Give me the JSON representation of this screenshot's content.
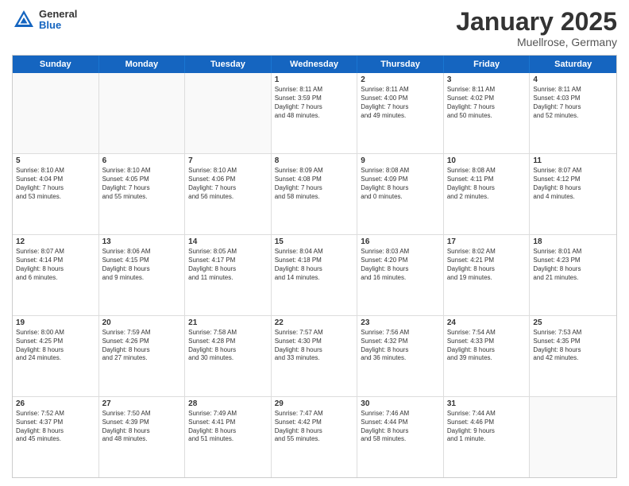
{
  "logo": {
    "general": "General",
    "blue": "Blue"
  },
  "header": {
    "title": "January 2025",
    "subtitle": "Muellrose, Germany"
  },
  "weekdays": [
    "Sunday",
    "Monday",
    "Tuesday",
    "Wednesday",
    "Thursday",
    "Friday",
    "Saturday"
  ],
  "weeks": [
    [
      {
        "day": "",
        "text": ""
      },
      {
        "day": "",
        "text": ""
      },
      {
        "day": "",
        "text": ""
      },
      {
        "day": "1",
        "text": "Sunrise: 8:11 AM\nSunset: 3:59 PM\nDaylight: 7 hours\nand 48 minutes."
      },
      {
        "day": "2",
        "text": "Sunrise: 8:11 AM\nSunset: 4:00 PM\nDaylight: 7 hours\nand 49 minutes."
      },
      {
        "day": "3",
        "text": "Sunrise: 8:11 AM\nSunset: 4:02 PM\nDaylight: 7 hours\nand 50 minutes."
      },
      {
        "day": "4",
        "text": "Sunrise: 8:11 AM\nSunset: 4:03 PM\nDaylight: 7 hours\nand 52 minutes."
      }
    ],
    [
      {
        "day": "5",
        "text": "Sunrise: 8:10 AM\nSunset: 4:04 PM\nDaylight: 7 hours\nand 53 minutes."
      },
      {
        "day": "6",
        "text": "Sunrise: 8:10 AM\nSunset: 4:05 PM\nDaylight: 7 hours\nand 55 minutes."
      },
      {
        "day": "7",
        "text": "Sunrise: 8:10 AM\nSunset: 4:06 PM\nDaylight: 7 hours\nand 56 minutes."
      },
      {
        "day": "8",
        "text": "Sunrise: 8:09 AM\nSunset: 4:08 PM\nDaylight: 7 hours\nand 58 minutes."
      },
      {
        "day": "9",
        "text": "Sunrise: 8:08 AM\nSunset: 4:09 PM\nDaylight: 8 hours\nand 0 minutes."
      },
      {
        "day": "10",
        "text": "Sunrise: 8:08 AM\nSunset: 4:11 PM\nDaylight: 8 hours\nand 2 minutes."
      },
      {
        "day": "11",
        "text": "Sunrise: 8:07 AM\nSunset: 4:12 PM\nDaylight: 8 hours\nand 4 minutes."
      }
    ],
    [
      {
        "day": "12",
        "text": "Sunrise: 8:07 AM\nSunset: 4:14 PM\nDaylight: 8 hours\nand 6 minutes."
      },
      {
        "day": "13",
        "text": "Sunrise: 8:06 AM\nSunset: 4:15 PM\nDaylight: 8 hours\nand 9 minutes."
      },
      {
        "day": "14",
        "text": "Sunrise: 8:05 AM\nSunset: 4:17 PM\nDaylight: 8 hours\nand 11 minutes."
      },
      {
        "day": "15",
        "text": "Sunrise: 8:04 AM\nSunset: 4:18 PM\nDaylight: 8 hours\nand 14 minutes."
      },
      {
        "day": "16",
        "text": "Sunrise: 8:03 AM\nSunset: 4:20 PM\nDaylight: 8 hours\nand 16 minutes."
      },
      {
        "day": "17",
        "text": "Sunrise: 8:02 AM\nSunset: 4:21 PM\nDaylight: 8 hours\nand 19 minutes."
      },
      {
        "day": "18",
        "text": "Sunrise: 8:01 AM\nSunset: 4:23 PM\nDaylight: 8 hours\nand 21 minutes."
      }
    ],
    [
      {
        "day": "19",
        "text": "Sunrise: 8:00 AM\nSunset: 4:25 PM\nDaylight: 8 hours\nand 24 minutes."
      },
      {
        "day": "20",
        "text": "Sunrise: 7:59 AM\nSunset: 4:26 PM\nDaylight: 8 hours\nand 27 minutes."
      },
      {
        "day": "21",
        "text": "Sunrise: 7:58 AM\nSunset: 4:28 PM\nDaylight: 8 hours\nand 30 minutes."
      },
      {
        "day": "22",
        "text": "Sunrise: 7:57 AM\nSunset: 4:30 PM\nDaylight: 8 hours\nand 33 minutes."
      },
      {
        "day": "23",
        "text": "Sunrise: 7:56 AM\nSunset: 4:32 PM\nDaylight: 8 hours\nand 36 minutes."
      },
      {
        "day": "24",
        "text": "Sunrise: 7:54 AM\nSunset: 4:33 PM\nDaylight: 8 hours\nand 39 minutes."
      },
      {
        "day": "25",
        "text": "Sunrise: 7:53 AM\nSunset: 4:35 PM\nDaylight: 8 hours\nand 42 minutes."
      }
    ],
    [
      {
        "day": "26",
        "text": "Sunrise: 7:52 AM\nSunset: 4:37 PM\nDaylight: 8 hours\nand 45 minutes."
      },
      {
        "day": "27",
        "text": "Sunrise: 7:50 AM\nSunset: 4:39 PM\nDaylight: 8 hours\nand 48 minutes."
      },
      {
        "day": "28",
        "text": "Sunrise: 7:49 AM\nSunset: 4:41 PM\nDaylight: 8 hours\nand 51 minutes."
      },
      {
        "day": "29",
        "text": "Sunrise: 7:47 AM\nSunset: 4:42 PM\nDaylight: 8 hours\nand 55 minutes."
      },
      {
        "day": "30",
        "text": "Sunrise: 7:46 AM\nSunset: 4:44 PM\nDaylight: 8 hours\nand 58 minutes."
      },
      {
        "day": "31",
        "text": "Sunrise: 7:44 AM\nSunset: 4:46 PM\nDaylight: 9 hours\nand 1 minute."
      },
      {
        "day": "",
        "text": ""
      }
    ]
  ]
}
